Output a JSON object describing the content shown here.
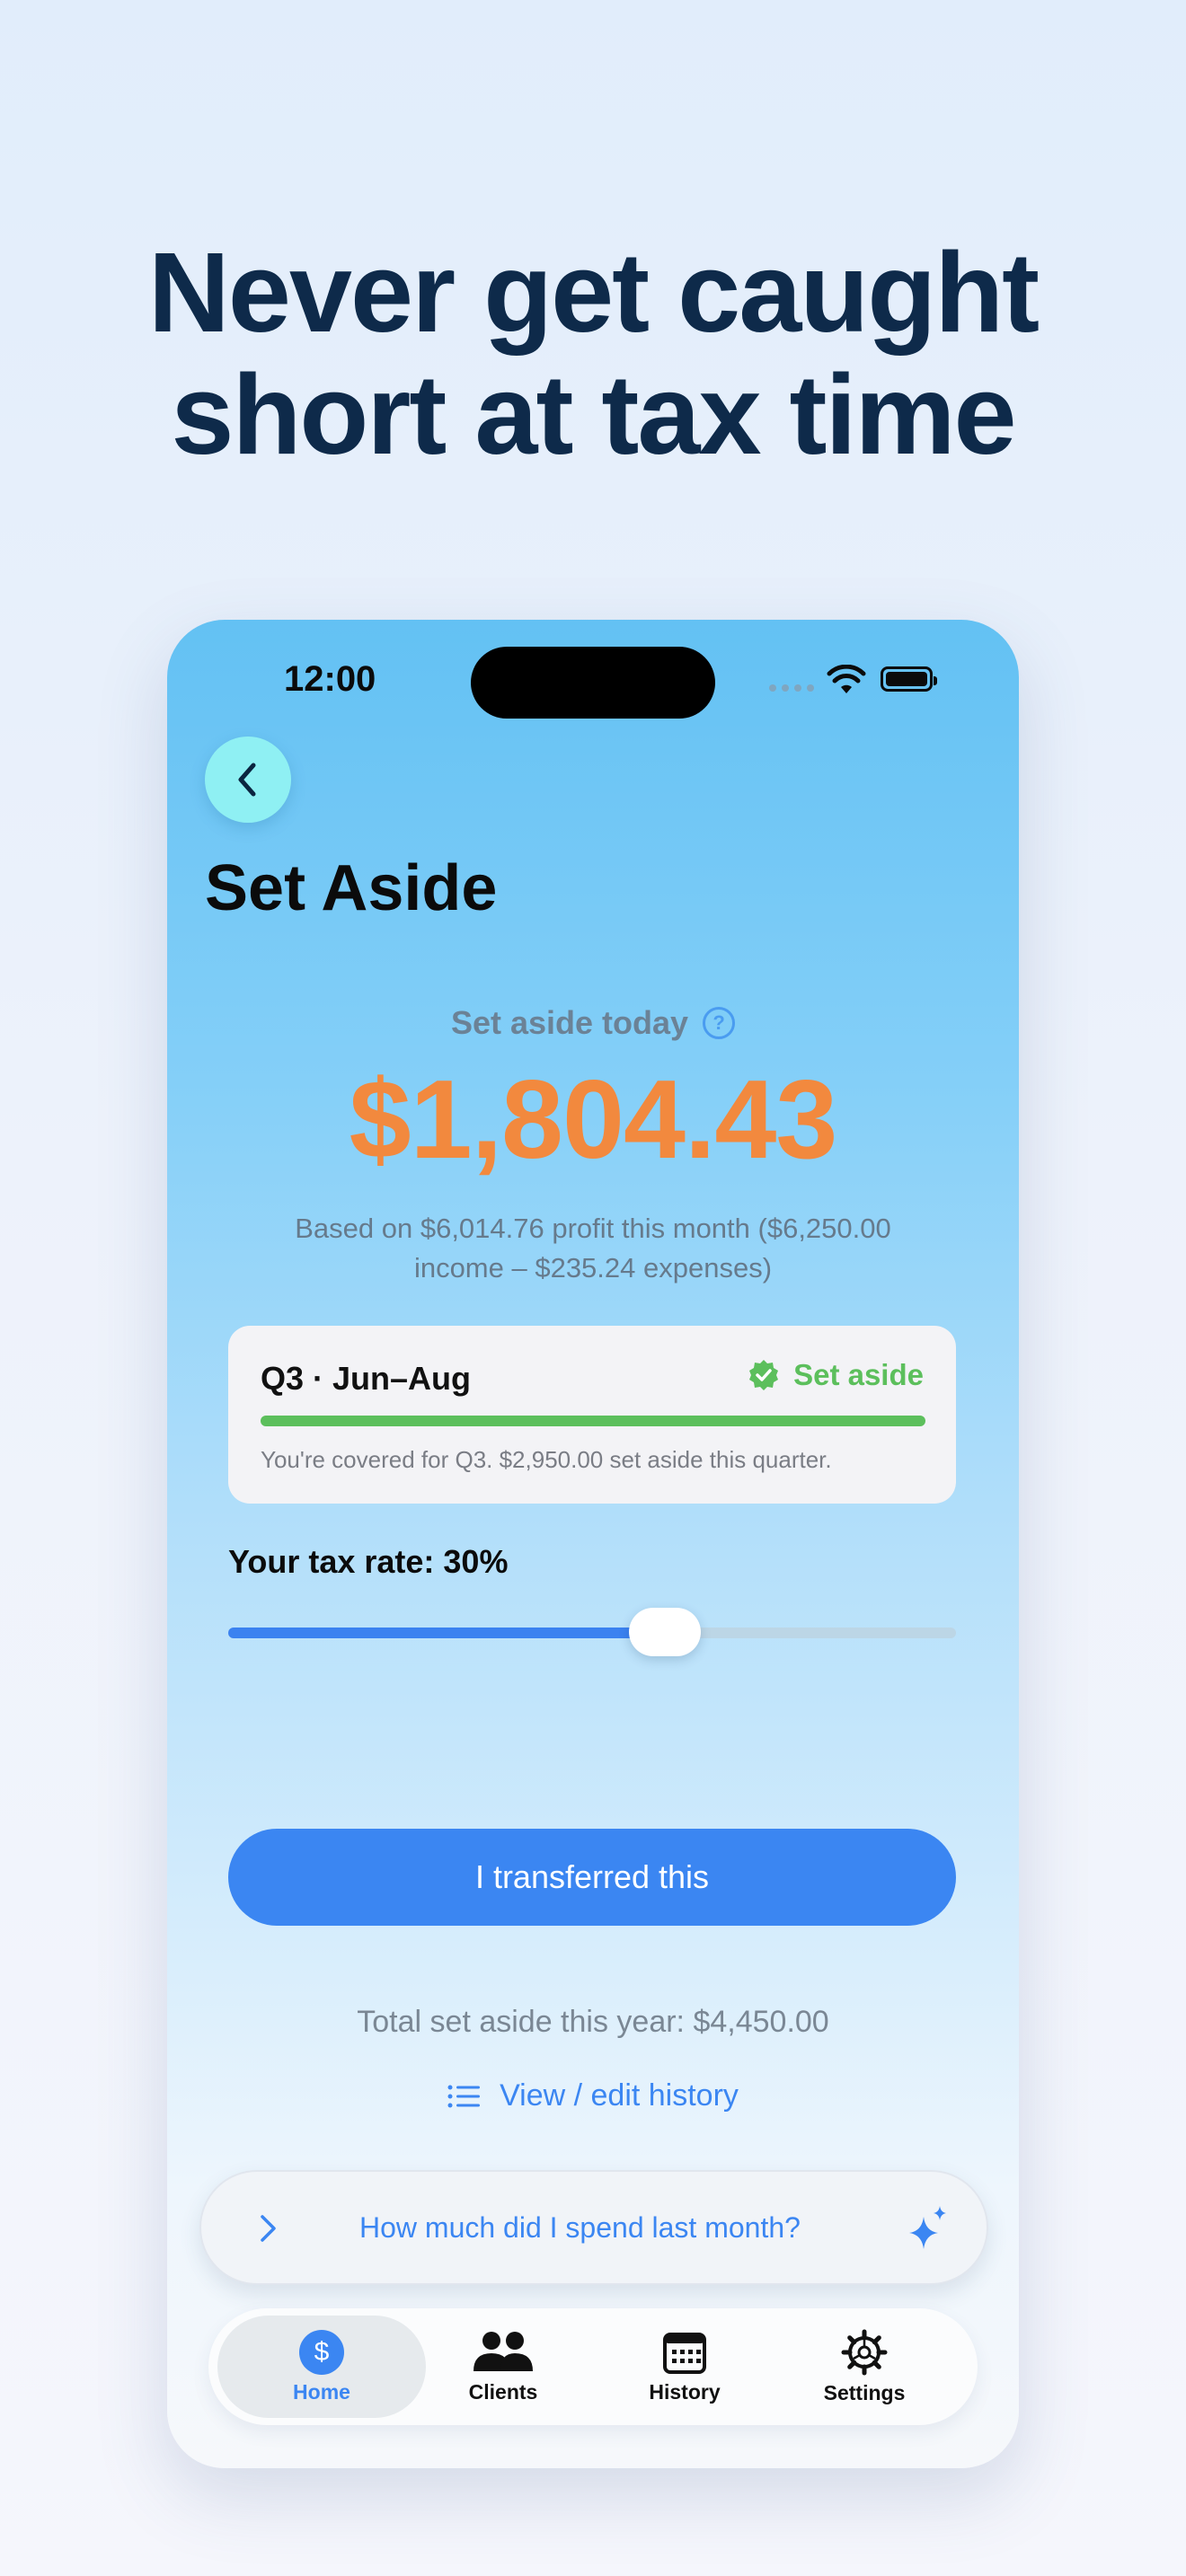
{
  "headline": {
    "line1": "Never get caught",
    "line2": "short at tax time"
  },
  "status_bar": {
    "time": "12:00"
  },
  "page": {
    "title": "Set Aside"
  },
  "summary": {
    "label": "Set aside today",
    "help_glyph": "?",
    "amount": "$1,804.43",
    "basis": "Based on $6,014.76 profit this month ($6,250.00 income – $235.24 expenses)"
  },
  "quarter": {
    "title": "Q3 · Jun–Aug",
    "status": "Set aside",
    "progress": 1.0,
    "note": "You're covered for Q3. $2,950.00 set aside this quarter."
  },
  "tax_rate": {
    "label": "Your tax rate: 30%",
    "value": 0.6
  },
  "actions": {
    "transfer_label": "I transferred this",
    "total": "Total set aside this year: $4,450.00",
    "history_label": "View / edit history"
  },
  "assistant": {
    "prompt": "How much did I spend last month?"
  },
  "tabs": [
    {
      "label": "Home",
      "icon": "dollar-icon",
      "active": true
    },
    {
      "label": "Clients",
      "icon": "people-icon",
      "active": false
    },
    {
      "label": "History",
      "icon": "calendar-icon",
      "active": false
    },
    {
      "label": "Settings",
      "icon": "gear-icon",
      "active": false
    }
  ],
  "colors": {
    "accent": "#3b86f2",
    "amount": "#f2893e",
    "success": "#5cbf5c",
    "headline": "#0e2a4a",
    "back_button": "#8ff0f3"
  },
  "home_icon_glyph": "$"
}
